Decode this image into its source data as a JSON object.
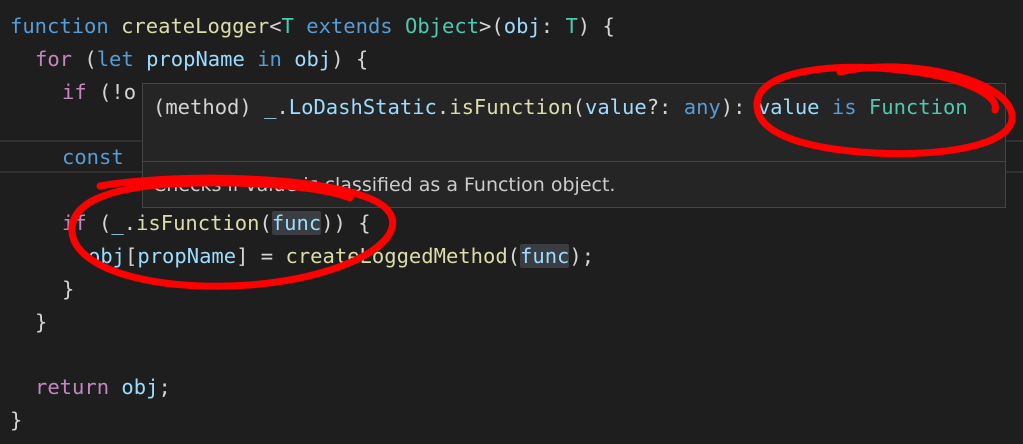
{
  "code": {
    "l1": {
      "k_function": "function",
      "name": "createLogger",
      "lt": "<",
      "T": "T",
      "k_extends": "extends",
      "Object": "Object",
      "rest1": ">(",
      "obj": "obj",
      ": ": ": ",
      "T2": "T",
      "end": ") {"
    },
    "l2": {
      "k_for": "for",
      "p1": " (",
      "k_let": "let",
      "propName": "propName",
      "k_in": "in",
      "obj": "obj",
      "end": ") {"
    },
    "l3": {
      "k_if": "if",
      "rest": " (!o"
    },
    "l4": {
      "k_const": "const"
    },
    "l5": {
      "k_if": "if",
      "p1": " (",
      "us": "_",
      "dot": ".",
      "fn": "isFunction",
      "p2": "(",
      "arg": "func",
      "end": ")) {"
    },
    "l6": {
      "obj": "obj",
      "b1": "[",
      "prop": "propName",
      "b2": "] = ",
      "fn": "createLoggedMethod",
      "p1": "(",
      "arg": "func",
      "end": ");"
    },
    "l7": {
      "brace": "}"
    },
    "l8": {
      "brace": "}"
    },
    "l10": {
      "k_return": "return",
      "obj": "obj",
      "end": ";"
    },
    "l11": {
      "brace": "}"
    }
  },
  "hover": {
    "sig_open": "(method) ",
    "us": "_",
    "dot": ".",
    "ns": "LoDashStatic",
    "dot2": ".",
    "fn": "isFunction",
    "paren": "(",
    "param": "value",
    "opt": "?: ",
    "any": "any",
    "close": "): ",
    "value": "value",
    "is": " is ",
    "ret": "Function",
    "doc": "Checks if value is classified as a Function object."
  },
  "colors": {
    "background": "#1e1e1e",
    "keyword": "#569cd6",
    "control": "#c586c0",
    "function": "#dcdcaa",
    "type": "#4ec9b0",
    "variable": "#9cdcfe",
    "annotation": "#ff0000"
  }
}
